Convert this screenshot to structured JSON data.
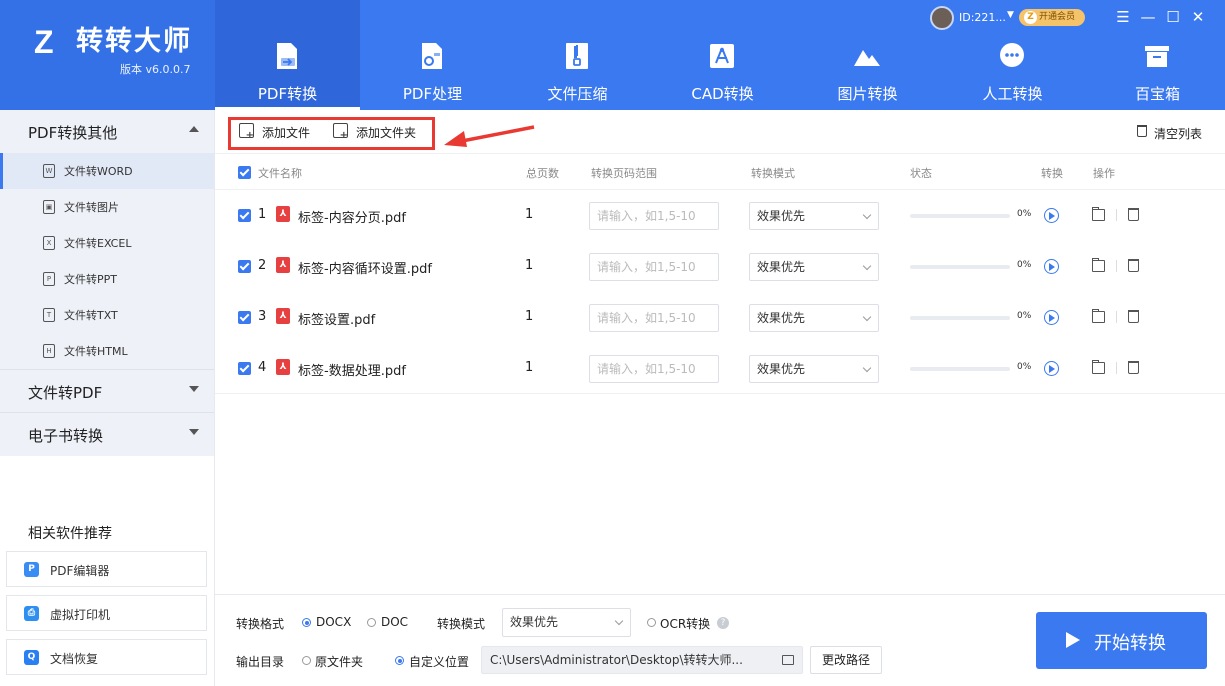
{
  "app": {
    "name": "转转大师",
    "version": "版本 v6.0.0.7",
    "user_id": "ID:221...",
    "vip_label": "开通会员"
  },
  "tabs": [
    {
      "label": "PDF转换",
      "icon": "pdf-convert-icon",
      "active": true
    },
    {
      "label": "PDF处理",
      "icon": "pdf-process-icon",
      "active": false
    },
    {
      "label": "文件压缩",
      "icon": "zip-icon",
      "active": false
    },
    {
      "label": "CAD转换",
      "icon": "cad-icon",
      "active": false
    },
    {
      "label": "图片转换",
      "icon": "image-icon",
      "active": false
    },
    {
      "label": "人工转换",
      "icon": "chat-icon",
      "active": false
    },
    {
      "label": "百宝箱",
      "icon": "toolbox-icon",
      "active": false
    }
  ],
  "window_controls": [
    "☰",
    "—",
    "☐",
    "✕"
  ],
  "sidebar": {
    "group_pdf_other": "PDF转换其他",
    "items": [
      {
        "label": "文件转WORD",
        "badge": "W"
      },
      {
        "label": "文件转图片",
        "badge": "▣"
      },
      {
        "label": "文件转EXCEL",
        "badge": "X"
      },
      {
        "label": "文件转PPT",
        "badge": "P"
      },
      {
        "label": "文件转TXT",
        "badge": "T"
      },
      {
        "label": "文件转HTML",
        "badge": "H"
      }
    ],
    "group_to_pdf": "文件转PDF",
    "group_ebook": "电子书转换",
    "recommend_title": "相关软件推荐",
    "recommend": [
      {
        "label": "PDF编辑器",
        "color": "#3a8cf5",
        "badge": "P"
      },
      {
        "label": "虚拟打印机",
        "color": "#2f8ff0",
        "badge": "⎙"
      },
      {
        "label": "文档恢复",
        "color": "#2a7ff2",
        "badge": "Q"
      }
    ]
  },
  "toolbar": {
    "add_file": "添加文件",
    "add_folder": "添加文件夹",
    "clear_list": "清空列表"
  },
  "table": {
    "headers": {
      "name": "文件名称",
      "pages": "总页数",
      "range": "转换页码范围",
      "mode": "转换模式",
      "status": "状态",
      "convert": "转换",
      "ops": "操作"
    },
    "range_placeholder": "请输入，如1,5-10",
    "rows": [
      {
        "num": "1",
        "name": "标签-内容分页.pdf",
        "pages": "1",
        "mode": "效果优先",
        "progress": 0,
        "pct": "0%"
      },
      {
        "num": "2",
        "name": "标签-内容循环设置.pdf",
        "pages": "1",
        "mode": "效果优先",
        "progress": 0,
        "pct": "0%"
      },
      {
        "num": "3",
        "name": "标签设置.pdf",
        "pages": "1",
        "mode": "效果优先",
        "progress": 0,
        "pct": "0%"
      },
      {
        "num": "4",
        "name": "标签-数据处理.pdf",
        "pages": "1",
        "mode": "效果优先",
        "progress": 0,
        "pct": "0%"
      }
    ]
  },
  "bottom": {
    "format_label": "转换格式",
    "format_docx": "DOCX",
    "format_doc": "DOC",
    "mode_label": "转换模式",
    "mode_value": "效果优先",
    "ocr_label": "OCR转换",
    "output_label": "输出目录",
    "output_original": "原文件夹",
    "output_custom": "自定义位置",
    "output_path": "C:\\Users\\Administrator\\Desktop\\转转大师...",
    "change_path": "更改路径",
    "start_label": "开始转换"
  },
  "colors": {
    "brand": "#3a79f0",
    "highlight": "#e83a32",
    "pdf_red": "#e64140"
  }
}
